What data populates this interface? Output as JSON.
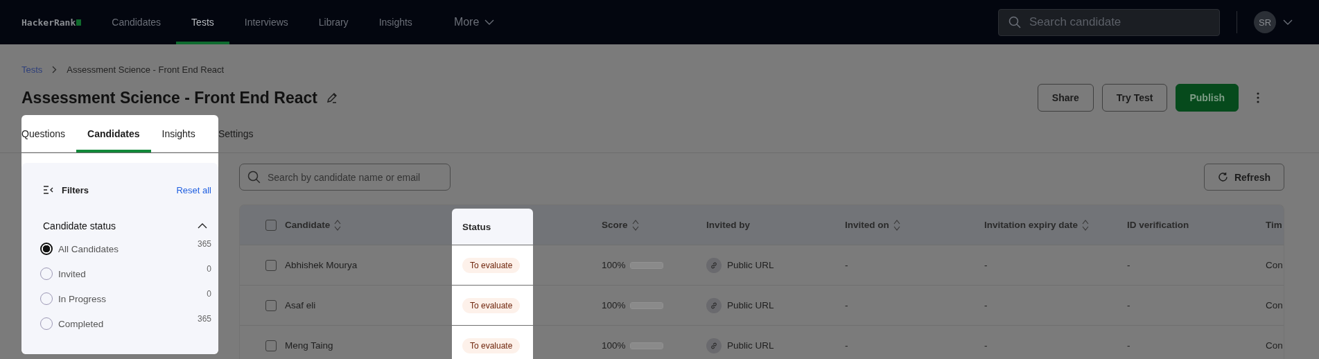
{
  "nav": {
    "logo": "HackerRank",
    "items": [
      {
        "label": "Candidates",
        "selected": false,
        "kind": "link"
      },
      {
        "label": "Tests",
        "selected": true,
        "kind": "link"
      },
      {
        "label": "Interviews",
        "selected": false,
        "kind": "link"
      },
      {
        "label": "Library",
        "selected": false,
        "kind": "link"
      },
      {
        "label": "Insights",
        "selected": false,
        "kind": "link"
      },
      {
        "label": "More",
        "selected": false,
        "kind": "dropdown"
      }
    ]
  },
  "search": {
    "placeholder": "Search candidate"
  },
  "user": {
    "initials": "SR"
  },
  "breadcrumb": [
    "Tests",
    "Assessment Science - Front End React"
  ],
  "title": "Assessment Science - Front End React",
  "actions": [
    {
      "label": "Share",
      "kind": "outline"
    },
    {
      "label": "Try Test",
      "kind": "outline"
    },
    {
      "label": "Publish",
      "kind": "primary"
    }
  ],
  "tabs": [
    {
      "label": "Questions",
      "selected": false,
      "spotlight": true
    },
    {
      "label": "Candidates",
      "selected": true,
      "spotlight": true
    },
    {
      "label": "Insights",
      "selected": false,
      "spotlight": true
    },
    {
      "label": "Settings",
      "selected": false,
      "spotlight": false
    }
  ],
  "filters": {
    "title": "Filters",
    "reset": "Reset all",
    "section": {
      "title": "Candidate status",
      "expanded": true,
      "options": [
        {
          "label": "All Candidates",
          "count": "365",
          "selected": true
        },
        {
          "label": "Invited",
          "count": "0",
          "selected": false
        },
        {
          "label": "In Progress",
          "count": "0",
          "selected": false
        },
        {
          "label": "Completed",
          "count": "365",
          "selected": false
        }
      ]
    }
  },
  "table": {
    "search_placeholder": "Search by candidate name or email",
    "refresh": "Refresh",
    "all_checked": false,
    "columns": [
      {
        "label": "Candidate",
        "sortable": true,
        "spotlight": false
      },
      {
        "label": "Status",
        "sortable": false,
        "spotlight": true
      },
      {
        "label": "Score",
        "sortable": true,
        "spotlight": false
      },
      {
        "label": "Invited by",
        "sortable": false,
        "spotlight": false
      },
      {
        "label": "Invited on",
        "sortable": true,
        "spotlight": false
      },
      {
        "label": "Invitation expiry date",
        "sortable": true,
        "spotlight": false
      },
      {
        "label": "ID verification",
        "sortable": false,
        "spotlight": false
      },
      {
        "label": "Tim",
        "sortable": false,
        "spotlight": false
      }
    ],
    "rows": [
      {
        "checked": false,
        "candidate": "Abhishek Mourya",
        "status": "To evaluate",
        "score": "100%",
        "level": 1,
        "invited_by": "Public URL",
        "invited_on": "-",
        "expiry": "-",
        "id_verification": "-",
        "column_8": "Con"
      },
      {
        "checked": false,
        "candidate": "Asaf eli",
        "status": "To evaluate",
        "score": "100%",
        "level": 1,
        "invited_by": "Public URL",
        "invited_on": "-",
        "expiry": "-",
        "id_verification": "-",
        "column_8": "Con"
      },
      {
        "checked": false,
        "candidate": "Meng Taing",
        "status": "To evaluate",
        "score": "100%",
        "level": 1,
        "invited_by": "Public URL",
        "invited_on": "-",
        "expiry": "-",
        "id_verification": "-",
        "column_8": "Con"
      }
    ]
  }
}
